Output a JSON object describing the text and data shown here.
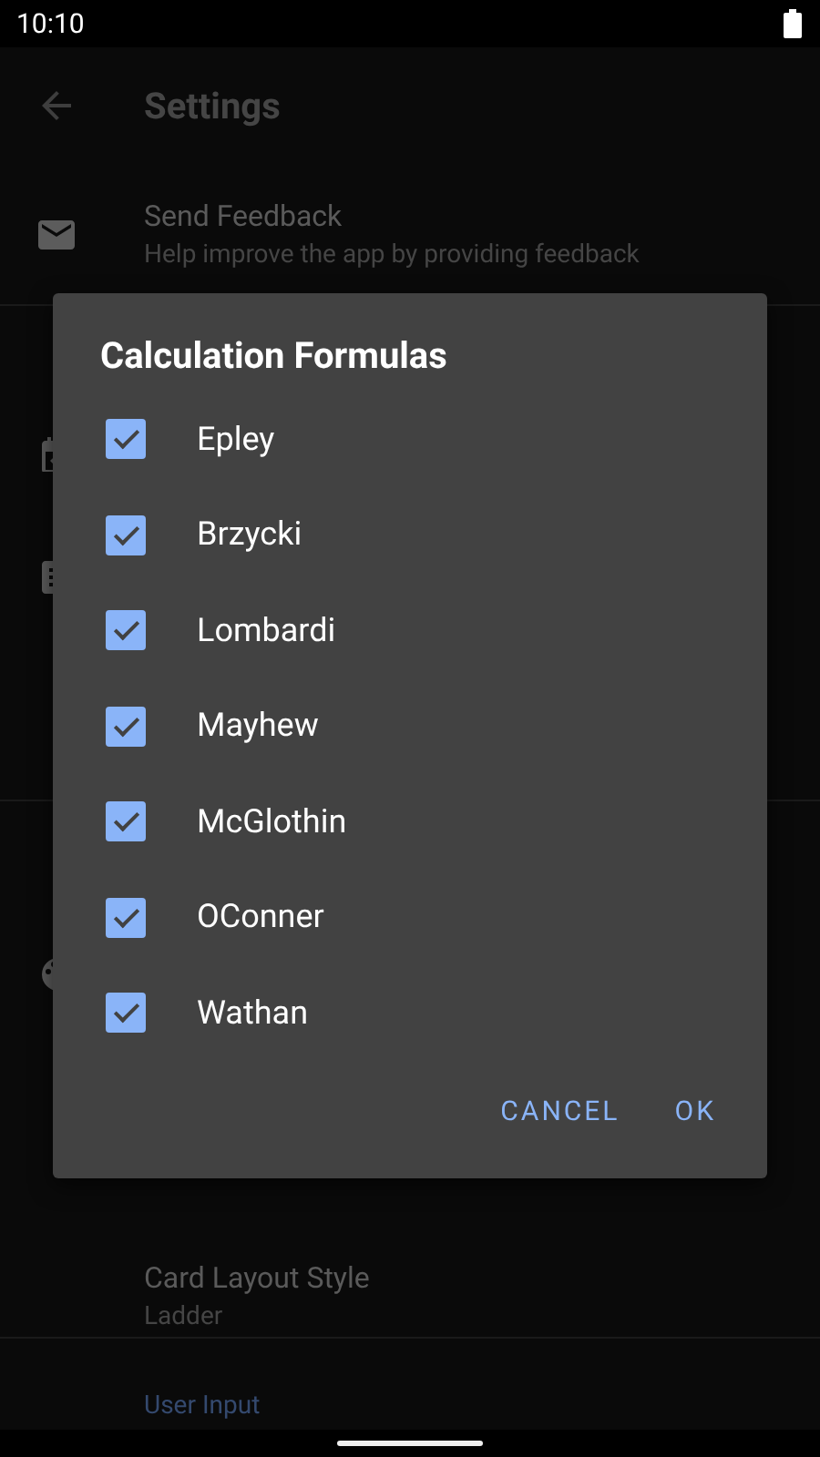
{
  "status_bar": {
    "time": "10:10"
  },
  "app_bar": {
    "title": "Settings"
  },
  "settings": [
    {
      "kind": "mail_row",
      "title": "Send Feedback",
      "summary": "Help improve the app by providing feedback"
    },
    {
      "kind": "plain_row",
      "title": "Card Layout Style",
      "summary": "Ladder"
    },
    {
      "kind": "header",
      "title": "User Input"
    }
  ],
  "dialog": {
    "title": "Calculation Formulas",
    "options": [
      {
        "label": "Epley",
        "checked": true
      },
      {
        "label": "Brzycki",
        "checked": true
      },
      {
        "label": "Lombardi",
        "checked": true
      },
      {
        "label": "Mayhew",
        "checked": true
      },
      {
        "label": "McGlothin",
        "checked": true
      },
      {
        "label": "OConner",
        "checked": true
      },
      {
        "label": "Wathan",
        "checked": true
      }
    ],
    "buttons": [
      "CANCEL",
      "OK"
    ]
  }
}
